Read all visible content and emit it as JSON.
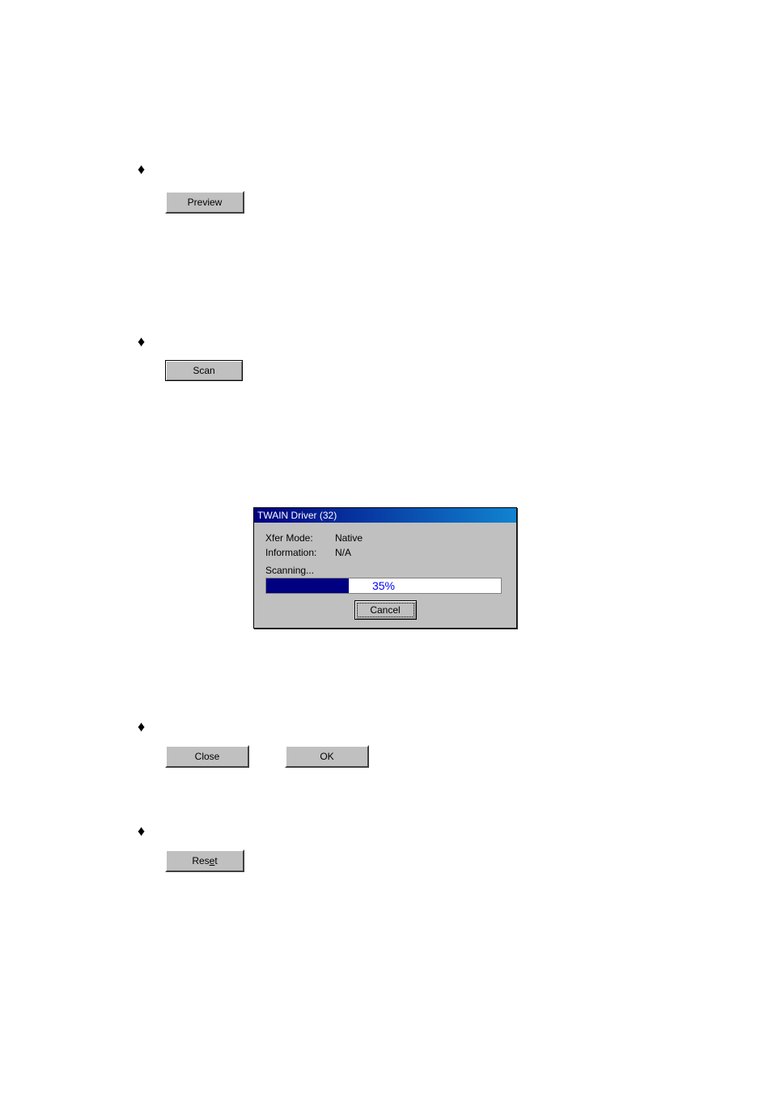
{
  "bullets": [
    "♦",
    "♦",
    "♦",
    "♦"
  ],
  "buttons": {
    "preview": "Preview",
    "scan": "Scan",
    "close": "Close",
    "ok": "OK",
    "reset_prefix": "Res",
    "reset_ul": "e",
    "reset_suffix": "t"
  },
  "dialog": {
    "title": "TWAIN Driver (32)",
    "rows": [
      {
        "label": "Xfer Mode:",
        "value": "Native"
      },
      {
        "label": "Information:",
        "value": "N/A"
      }
    ],
    "status": "Scanning...",
    "progress_percent": 35,
    "progress_text": "35%",
    "cancel": "Cancel"
  }
}
